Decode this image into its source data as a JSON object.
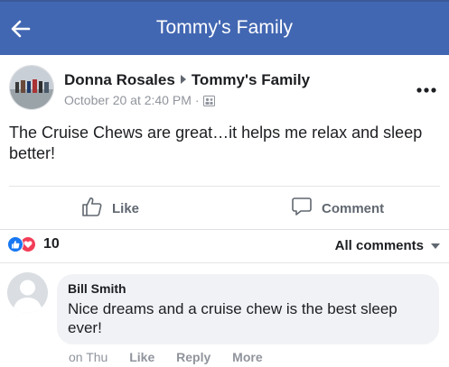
{
  "header": {
    "title": "Tommy's Family",
    "bg_color": "#4267b2"
  },
  "post": {
    "author": "Donna Rosales",
    "target_group": "Tommy's Family",
    "timestamp": "October 20 at 2:40 PM",
    "separator": "·",
    "text": "The Cruise Chews are great…it helps me relax and sleep better!",
    "actions": {
      "like_label": "Like",
      "comment_label": "Comment"
    },
    "reactions": {
      "count": "10",
      "types": [
        "like",
        "love"
      ]
    },
    "comments_filter": "All comments"
  },
  "comment": {
    "author": "Bill Smith",
    "text": "Nice dreams and a cruise chew is the best sleep ever!",
    "time": "on Thu",
    "like_label": "Like",
    "reply_label": "Reply",
    "more_label": "More"
  },
  "colors": {
    "accent": "#4267b2",
    "like_blue": "#1877f2",
    "love_red": "#f33e58",
    "muted": "#90949c"
  },
  "icons": [
    "back-arrow-icon",
    "audience-icon",
    "more-icon",
    "like-thumb-icon",
    "comment-bubble-icon",
    "like-reaction-icon",
    "love-reaction-icon",
    "dropdown-triangle-icon"
  ]
}
